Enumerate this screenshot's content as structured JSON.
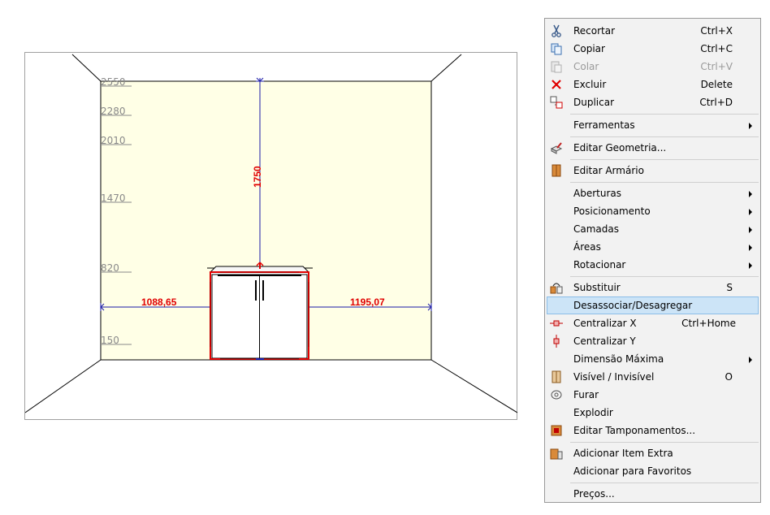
{
  "viewport": {
    "height_marks": [
      "2550",
      "2280",
      "2010",
      "1470",
      "820",
      "150"
    ],
    "dimensions": {
      "height": "1750",
      "left_clearance": "1088,65",
      "right_clearance": "1195,07"
    }
  },
  "context_menu": {
    "cut": {
      "label": "Recortar",
      "shortcut": "Ctrl+X",
      "icon": "scissors-icon"
    },
    "copy": {
      "label": "Copiar",
      "shortcut": "Ctrl+C",
      "icon": "copy-icon"
    },
    "paste": {
      "label": "Colar",
      "shortcut": "Ctrl+V",
      "icon": "paste-icon"
    },
    "delete": {
      "label": "Excluir",
      "shortcut": "Delete",
      "icon": "delete-x-icon"
    },
    "duplicate": {
      "label": "Duplicar",
      "shortcut": "Ctrl+D",
      "icon": "duplicate-icon"
    },
    "tools": {
      "label": "Ferramentas"
    },
    "edit_geometry": {
      "label": "Editar Geometria...",
      "icon": "edit-geometry-icon"
    },
    "edit_cabinet": {
      "label": "Editar Armário",
      "icon": "cabinet-icon"
    },
    "openings": {
      "label": "Aberturas"
    },
    "positioning": {
      "label": "Posicionamento"
    },
    "layers": {
      "label": "Camadas"
    },
    "areas": {
      "label": "Áreas"
    },
    "rotate": {
      "label": "Rotacionar"
    },
    "replace": {
      "label": "Substituir",
      "shortcut": "S",
      "icon": "replace-icon"
    },
    "disassociate": {
      "label": "Desassociar/Desagregar"
    },
    "center_x": {
      "label": "Centralizar X",
      "shortcut": "Ctrl+Home",
      "icon": "center-x-icon"
    },
    "center_y": {
      "label": "Centralizar Y",
      "icon": "center-y-icon"
    },
    "max_dimension": {
      "label": "Dimensão Máxima"
    },
    "visible": {
      "label": "Visível / Invisível",
      "shortcut": "O",
      "icon": "visibility-icon"
    },
    "drill": {
      "label": "Furar",
      "icon": "drill-icon"
    },
    "explode": {
      "label": "Explodir"
    },
    "edit_covers": {
      "label": "Editar Tamponamentos...",
      "icon": "covers-icon"
    },
    "add_extra": {
      "label": "Adicionar Item Extra",
      "icon": "extra-item-icon"
    },
    "add_favorites": {
      "label": "Adicionar para Favoritos"
    },
    "prices": {
      "label": "Preços..."
    }
  }
}
